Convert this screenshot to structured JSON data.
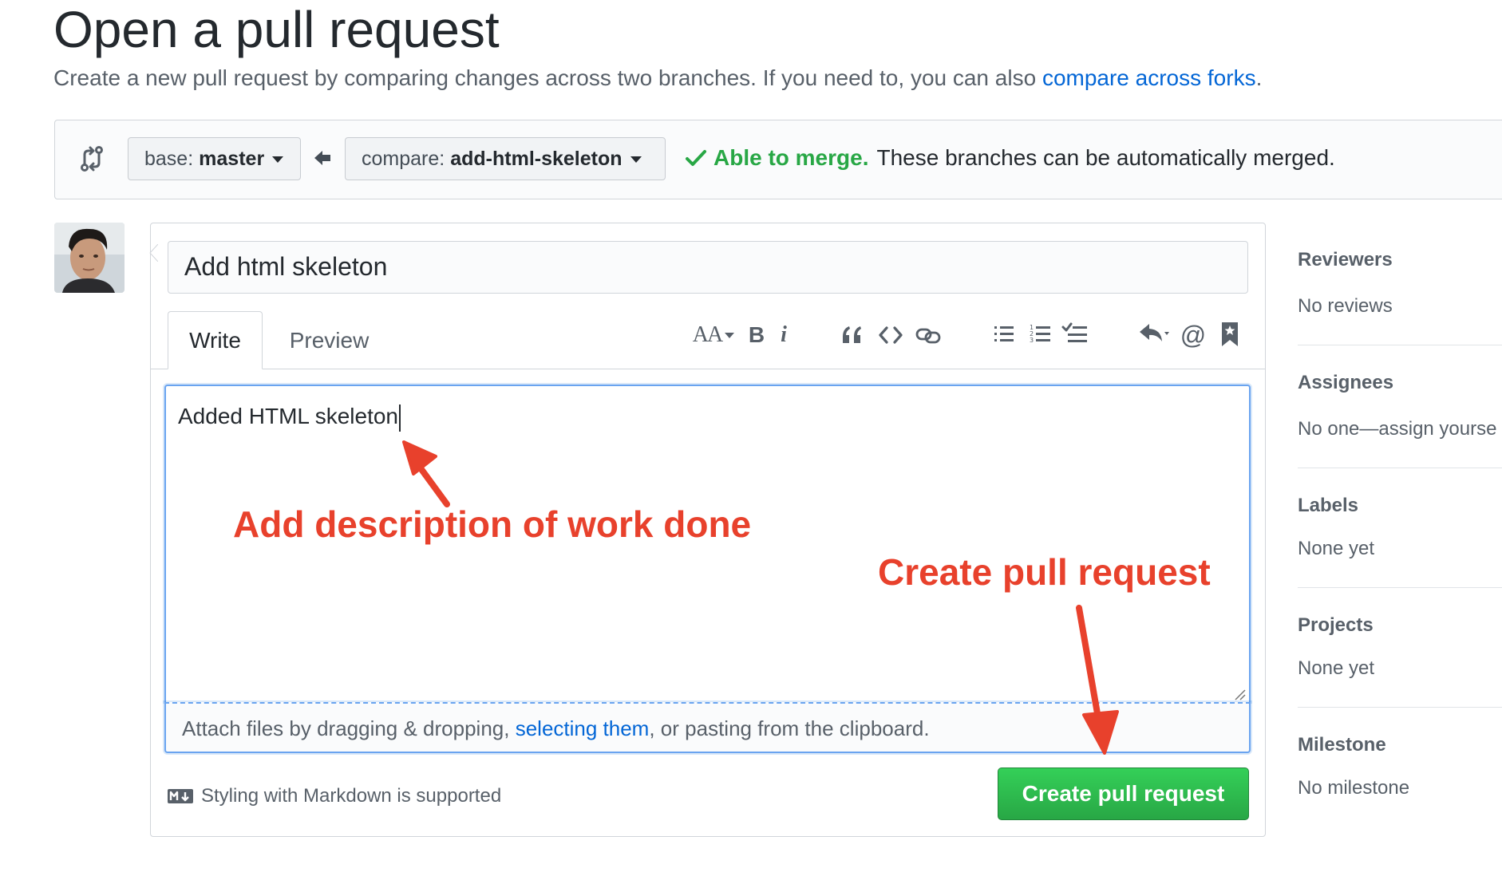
{
  "header": {
    "title": "Open a pull request",
    "subtitle_prefix": "Create a new pull request by comparing changes across two branches. If you need to, you can also ",
    "subtitle_link": "compare across forks",
    "subtitle_suffix": "."
  },
  "range": {
    "base_label": "base:",
    "base_value": "master",
    "compare_label": "compare:",
    "compare_value": "add-html-skeleton",
    "merge_ok": "Able to merge.",
    "merge_msg": "These branches can be automatically merged."
  },
  "form": {
    "title_value": "Add html skeleton",
    "tabs": {
      "write": "Write",
      "preview": "Preview"
    },
    "toolbar": {
      "heading": "AA",
      "bold": "B",
      "italic": "i",
      "quote": "“",
      "code": "<>",
      "link": "link",
      "bulleted_list": "bullets",
      "numbered_list": "numbers",
      "task_list": "tasks",
      "reply": "reply",
      "mention": "@",
      "reference": "bookmark"
    },
    "body_value": "Added HTML skeleton",
    "attach_prefix": "Attach files by dragging & dropping, ",
    "attach_link": "selecting them",
    "attach_suffix": ", or pasting from the clipboard.",
    "markdown_note": "Styling with Markdown is supported",
    "submit_label": "Create pull request"
  },
  "annotations": {
    "description": "Add description of work done",
    "create": "Create pull request",
    "color": "#e8412c"
  },
  "sidebar": {
    "sections": [
      {
        "heading": "Reviewers",
        "value": "No reviews"
      },
      {
        "heading": "Assignees",
        "value": "No one—assign yourse"
      },
      {
        "heading": "Labels",
        "value": "None yet"
      },
      {
        "heading": "Projects",
        "value": "None yet"
      },
      {
        "heading": "Milestone",
        "value": "No milestone"
      }
    ]
  },
  "colors": {
    "link": "#0366d6",
    "success": "#28a745",
    "primary_button": "#2ea44f"
  }
}
